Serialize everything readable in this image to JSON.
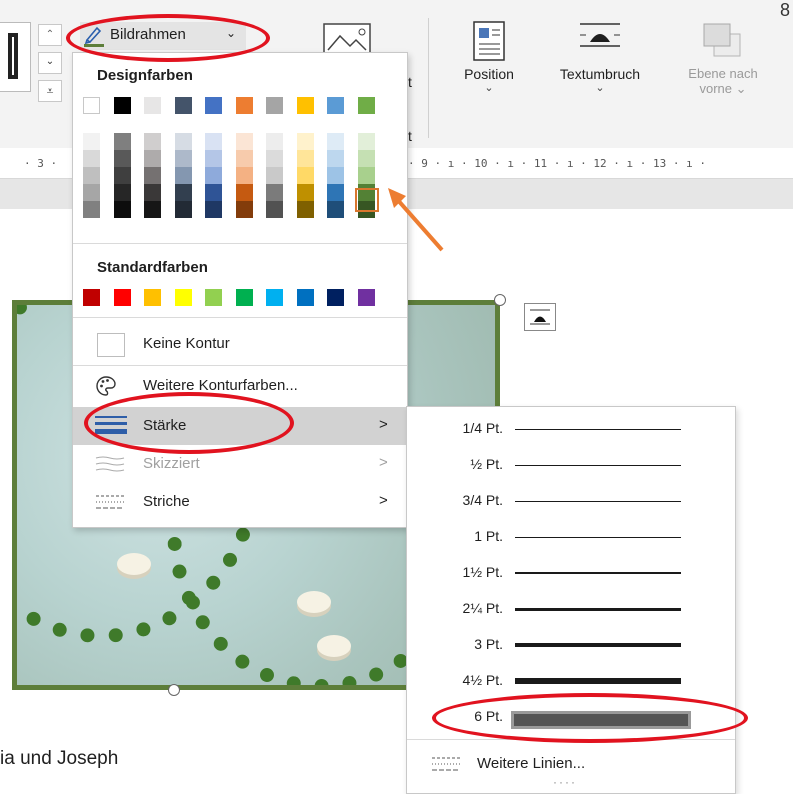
{
  "ribbon": {
    "bildrahmen_label": "Bildrahmen",
    "position_label": "Position",
    "textumbruch_label": "Textumbruch",
    "ebene_line1": "Ebene nach",
    "ebene_line2": "vorne",
    "partial_t": "t",
    "corner_glyph": "8"
  },
  "ruler": {
    "ticks": [
      "· 3 ·",
      "· 9 · ı · 10 · ı · 11 · ı · 12 · ı · 13 · ı ·"
    ]
  },
  "menu": {
    "design_title": "Designfarben",
    "standard_title": "Standardfarben",
    "theme_top_row": [
      "#ffffff",
      "#000000",
      "#e7e6e6",
      "#44546a",
      "#4472c4",
      "#ed7d31",
      "#a5a5a5",
      "#ffc000",
      "#5b9bd5",
      "#70ad47"
    ],
    "theme_columns": [
      [
        "#f2f2f2",
        "#d9d9d9",
        "#bfbfbf",
        "#a6a6a6",
        "#808080"
      ],
      [
        "#7f7f7f",
        "#595959",
        "#3f3f3f",
        "#262626",
        "#0d0d0d"
      ],
      [
        "#d0cece",
        "#aeabab",
        "#757171",
        "#3a3838",
        "#161616"
      ],
      [
        "#d6dce4",
        "#adb9ca",
        "#8497b0",
        "#323f4f",
        "#222a35"
      ],
      [
        "#d9e2f3",
        "#b4c6e7",
        "#8eaadb",
        "#2f5496",
        "#1f3864"
      ],
      [
        "#fbe5d5",
        "#f7cbac",
        "#f4b183",
        "#c55a11",
        "#833c0b"
      ],
      [
        "#ededed",
        "#dbdbdb",
        "#c9c9c9",
        "#7b7b7b",
        "#525252"
      ],
      [
        "#fff2cc",
        "#ffe599",
        "#ffd966",
        "#bf9000",
        "#7f6000"
      ],
      [
        "#deebf6",
        "#bdd7ee",
        "#9dc3e6",
        "#2e75b5",
        "#1f4e79"
      ],
      [
        "#e2efd9",
        "#c5e0b3",
        "#a8d08d",
        "#538135",
        "#375623"
      ]
    ],
    "standard_colors": [
      "#c00000",
      "#ff0000",
      "#ffc000",
      "#ffff00",
      "#92d050",
      "#00b050",
      "#00b0f0",
      "#0070c0",
      "#002060",
      "#7030a0"
    ],
    "keine_kontur": "Keine Kontur",
    "weitere_konturfarben": "Weitere Konturfarben...",
    "staerke": "Stärke",
    "skizziert": "Skizziert",
    "striche": "Striche",
    "arrow": ">"
  },
  "submenu": {
    "weights": [
      {
        "label": "1/4 Pt.",
        "pt": 0.25
      },
      {
        "label": "½ Pt.",
        "pt": 0.5
      },
      {
        "label": "3/4 Pt.",
        "pt": 0.75
      },
      {
        "label": "1 Pt.",
        "pt": 1
      },
      {
        "label": "1½ Pt.",
        "pt": 1.5
      },
      {
        "label": "2¼ Pt.",
        "pt": 2.25
      },
      {
        "label": "3 Pt.",
        "pt": 3
      },
      {
        "label": "4½ Pt.",
        "pt": 4.5
      },
      {
        "label": "6 Pt.",
        "pt": 6
      }
    ],
    "weitere_linien": "Weitere Linien...",
    "more_dots": "····"
  },
  "document": {
    "caption": "ia und Joseph"
  },
  "colors": {
    "accent_red": "#e1131f",
    "orange_arrow": "#ed7d31",
    "frame_green": "#5d7e3a"
  },
  "icons": [
    "brush-icon",
    "picture-icon",
    "position-icon",
    "text-wrap-icon",
    "bring-forward-icon",
    "palette-icon",
    "line-weight-icon",
    "sketch-icon",
    "dashes-icon"
  ]
}
